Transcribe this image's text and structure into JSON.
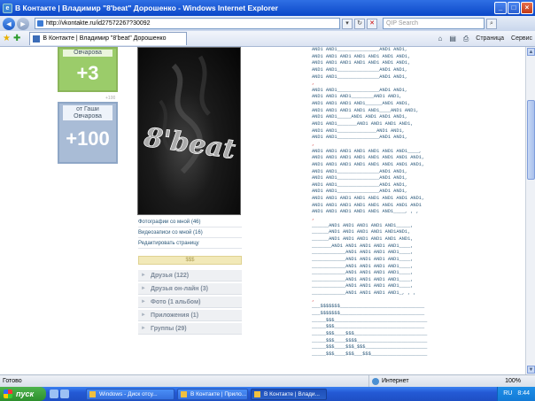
{
  "window": {
    "title": "В Контакте | Владимир \"8'beat\" Дорошенко - Windows Internet Explorer",
    "controls": [
      "_",
      "□",
      "×"
    ]
  },
  "address": {
    "url": "http://vkontakte.ru/id27572267?30092",
    "search_placeholder": "QIP Search"
  },
  "tab": {
    "label": "В Контакте | Владимир \"8'beat\" Дорошенко"
  },
  "commands": {
    "page": "Страница",
    "tools": "Сервис"
  },
  "votes": [
    {
      "label": "Овчарова",
      "value": "+3",
      "extra": "+100"
    },
    {
      "label": "от Гаши Овчарова",
      "value": "+100"
    }
  ],
  "photo": {
    "art_text": "8'beat"
  },
  "profile_links": [
    "Фотографии со мной (46)",
    "Видеозаписи со мной (16)",
    "Редактировать страницу"
  ],
  "bar_label": "$$$",
  "sections": [
    "Друзья (122)",
    "Друзья он-лайн (3)",
    "Фото (1 альбом)",
    "Приложения (1)",
    "Группы (29)"
  ],
  "ascii_lines": [
    "AND1 AND1_______________AND1 AND1,",
    "AND1 AND1 AND1 AND1 AND1 AND1 AND1,",
    "AND1 AND1 AND1 AND1 AND1 AND1 AND1,",
    "AND1 AND1_______________AND1 AND1,",
    "AND1 AND1_______________AND1 AND1,",
    ",",
    "AND1 AND1_______________AND1 AND1,",
    "AND1 AND1 AND1________AND1 AND1,",
    "AND1 AND1 AND1 AND1______AND1 AND1,",
    "AND1 AND1 AND1 AND1 AND1____AND1 AND1,",
    "AND1 AND1_____AND1 AND1 AND1 AND1,",
    "AND1 AND1_______AND1 AND1 AND1 AND1,",
    "AND1 AND1______________AND1 AND1,",
    "AND1 AND1_______________AND1 AND1,",
    ",",
    "AND1 AND1 AND1 AND1 AND1 AND1 AND1____,",
    "AND1 AND1 AND1 AND1 AND1 AND1 AND1 AND1,",
    "AND1 AND1 AND1 AND1 AND1 AND1 AND1 AND1,",
    "AND1 AND1_______________AND1 AND1,",
    "AND1 AND1_______________AND1 AND1,",
    "AND1 AND1_______________AND1 AND1,",
    "AND1 AND1_______________AND1 AND1,",
    "AND1 AND1 AND1 AND1 AND1 AND1 AND1 AND1,",
    "AND1 AND1 AND1 AND1 AND1 AND1 AND1 AND1",
    "AND1 AND1 AND1 AND1 AND1 AND1____, , ,",
    ",",
    "______AND1 AND1 AND1 AND1 AND1_____,",
    "______AND1 AND1 AND1 AND1 AND1AND1,",
    "______AND1 AND1 AND1 AND1 AND1 AND1,",
    "_______AND1 AND1 AND1 AND1 AND1____,",
    "____________AND1 AND1 AND1 AND1____,",
    "____________AND1 AND1 AND1 AND1____,",
    "____________AND1 AND1 AND1 AND1____,",
    "____________AND1 AND1 AND1 AND1____,",
    "____________AND1 AND1 AND1 AND1____,",
    "____________AND1 AND1 AND1 AND1____,",
    "____________AND1 AND1 AND1 AND1_, , ,",
    ",",
    "___$$$$$$$______________________________",
    "___$$$$$$$______________________________",
    "_____$$$_________________________________",
    "_____$$$________________________________",
    "_____$$$____$$$__________________________",
    "_____$$$____$$$$_________________________",
    "_____$$$____$$$_$$$______________________",
    "_____$$$____$$$___$$$____________________"
  ],
  "status": {
    "left": "Готово",
    "zone": "Интернет",
    "zoom": "100%"
  },
  "taskbar": {
    "start": "пуск",
    "tasks": [
      "Windows - Диск отсу...",
      "В Контакте | Прило...",
      "В Контакте | Влади..."
    ],
    "lang": "RU",
    "time": "8:44"
  },
  "colors": {
    "vote_green": "#9bcc6a",
    "vote_blue": "#a9bcd6",
    "link": "#2b587a",
    "accent_red": "#d02020"
  }
}
